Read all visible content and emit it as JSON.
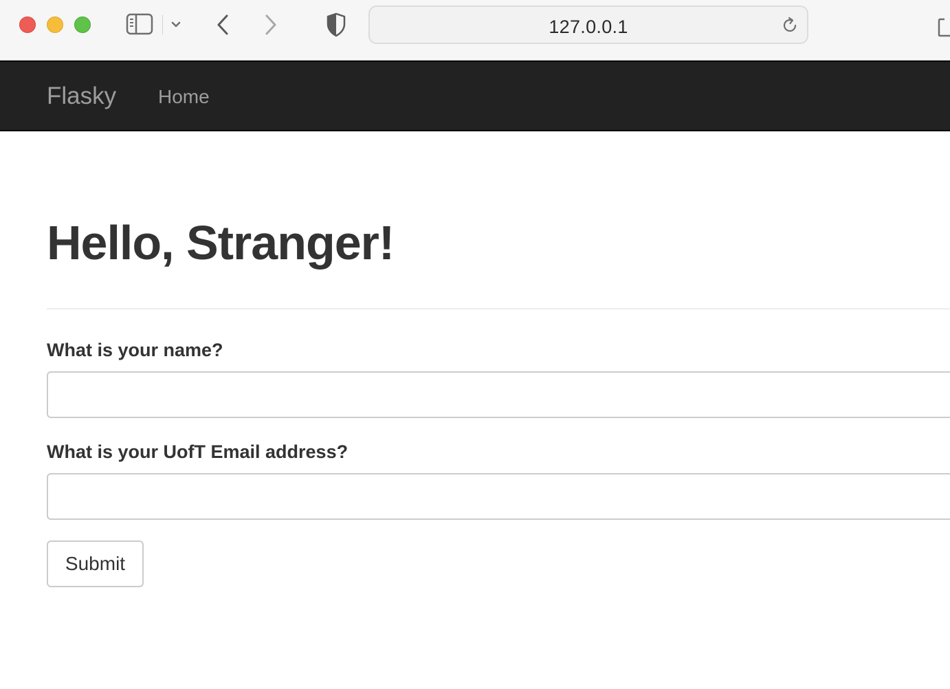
{
  "browser": {
    "url": "127.0.0.1",
    "traffic_colors": {
      "close": "#ee5d55",
      "minimize": "#f6bd3b",
      "maximize": "#5fc34a"
    },
    "icons": [
      "sidebar-icon",
      "chevron-down-icon",
      "back-arrow-icon",
      "forward-arrow-icon",
      "shield-icon",
      "reload-icon",
      "share-icon"
    ]
  },
  "navbar": {
    "brand": "Flasky",
    "links": [
      {
        "label": "Home"
      }
    ],
    "background": "#222222",
    "text_color": "#9d9d9d"
  },
  "main": {
    "title": "Hello, Stranger!",
    "form": {
      "name_label": "What is your name?",
      "name_value": "",
      "email_label": "What is your UofT Email address?",
      "email_value": "",
      "submit_label": "Submit"
    }
  }
}
